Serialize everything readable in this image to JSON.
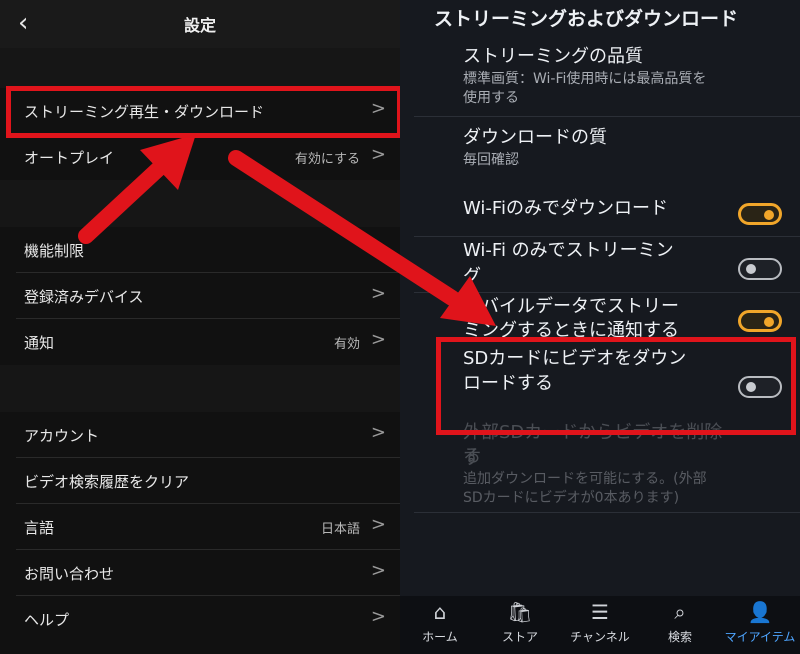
{
  "left": {
    "back_icon": "chevron-left-icon",
    "title": "設定",
    "rows": {
      "streaming": {
        "label": "ストリーミング再生・ダウンロード",
        "value": ""
      },
      "autoplay": {
        "label": "オートプレイ",
        "value": "有効にする"
      },
      "restrictions": {
        "label": "機能制限",
        "value": ""
      },
      "devices": {
        "label": "登録済みデバイス",
        "value": ""
      },
      "notifications": {
        "label": "通知",
        "value": "有効"
      },
      "account": {
        "label": "アカウント",
        "value": ""
      },
      "clear_history": {
        "label": "ビデオ検索履歴をクリア",
        "value": ""
      },
      "language": {
        "label": "言語",
        "value": "日本語"
      },
      "contact": {
        "label": "お問い合わせ",
        "value": ""
      },
      "help": {
        "label": "ヘルプ",
        "value": ""
      }
    },
    "chevron": ">"
  },
  "right": {
    "title": "ストリーミングおよびダウンロード",
    "quality": {
      "title": "ストリーミングの品質",
      "subtitle_line1": "標準画質：Wi-Fi使用時には最高品質を",
      "subtitle_line2": "使用する"
    },
    "download_quality": {
      "title": "ダウンロードの質",
      "subtitle": "毎回確認"
    },
    "wifi_download": {
      "title": "Wi-Fiのみでダウンロード",
      "enabled": true
    },
    "wifi_streaming": {
      "title_line1": "Wi-Fi のみでストリーミン",
      "title_line2": "グ",
      "enabled": false
    },
    "mobile_notify": {
      "title_line1": "モバイルデータでストリー",
      "title_line2": "ミングするときに通知する",
      "enabled": true
    },
    "sd_download": {
      "title_line1": "SDカードにビデオをダウン",
      "title_line2": "ロードする",
      "enabled": false
    },
    "sd_delete": {
      "title_line1": "外部SDカードからビデオを削除す",
      "title_line2": "る",
      "subtitle_line1": "追加ダウンロードを可能にする。(外部",
      "subtitle_line2": "SDカードにビデオが0本あります)"
    }
  },
  "nav": {
    "items": [
      {
        "label": "ホーム",
        "icon": "home-icon"
      },
      {
        "label": "ストア",
        "icon": "store-bag-icon"
      },
      {
        "label": "チャンネル",
        "icon": "channels-icon"
      },
      {
        "label": "検索",
        "icon": "search-icon"
      },
      {
        "label": "マイアイテム",
        "icon": "person-icon"
      }
    ],
    "active_index": 4
  },
  "colors": {
    "highlight": "#e0141b",
    "toggle_on": "#f1a62a",
    "nav_active": "#4ea5ff"
  }
}
